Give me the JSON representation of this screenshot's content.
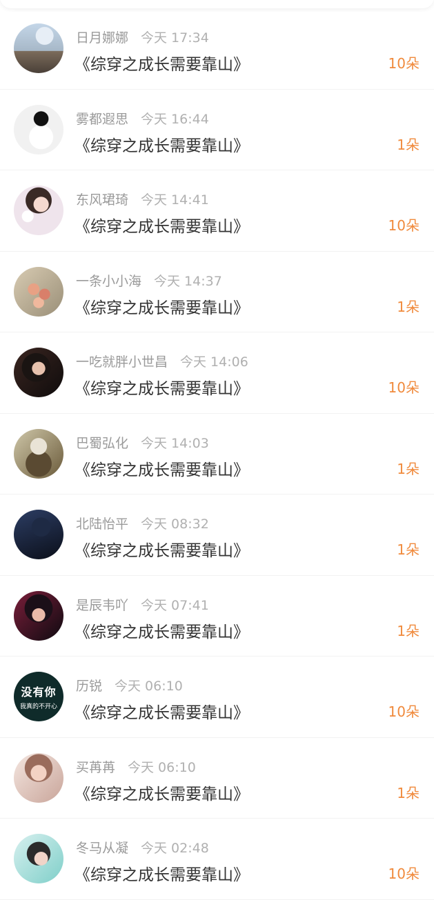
{
  "rows": [
    {
      "name": "日月娜娜",
      "time": "今天  17:34",
      "title": "《综穿之成长需要靠山》",
      "count": "10朵"
    },
    {
      "name": "雾都遐思",
      "time": "今天  16:44",
      "title": "《综穿之成长需要靠山》",
      "count": "1朵"
    },
    {
      "name": "东风珺琦",
      "time": "今天  14:41",
      "title": "《综穿之成长需要靠山》",
      "count": "10朵"
    },
    {
      "name": "一条小小海",
      "time": "今天  14:37",
      "title": "《综穿之成长需要靠山》",
      "count": "1朵"
    },
    {
      "name": "一吃就胖小世昌",
      "time": "今天  14:06",
      "title": "《综穿之成长需要靠山》",
      "count": "10朵"
    },
    {
      "name": "巴蜀弘化",
      "time": "今天  14:03",
      "title": "《综穿之成长需要靠山》",
      "count": "1朵"
    },
    {
      "name": "北陆怡平",
      "time": "今天  08:32",
      "title": "《综穿之成长需要靠山》",
      "count": "1朵"
    },
    {
      "name": "是辰韦吖",
      "time": "今天  07:41",
      "title": "《综穿之成长需要靠山》",
      "count": "1朵"
    },
    {
      "name": "历锐",
      "time": "今天  06:10",
      "title": "《综穿之成长需要靠山》",
      "count": "10朵",
      "avatar_text": "没有你",
      "avatar_subtext": "我真的不开心"
    },
    {
      "name": "买苒苒",
      "time": "今天  06:10",
      "title": "《综穿之成长需要靠山》",
      "count": "1朵"
    },
    {
      "name": "冬马从凝",
      "time": "今天  02:48",
      "title": "《综穿之成长需要靠山》",
      "count": "10朵"
    }
  ],
  "colors": {
    "count": "#f08a3c",
    "title": "#333333",
    "meta": "#9a9a9a"
  }
}
